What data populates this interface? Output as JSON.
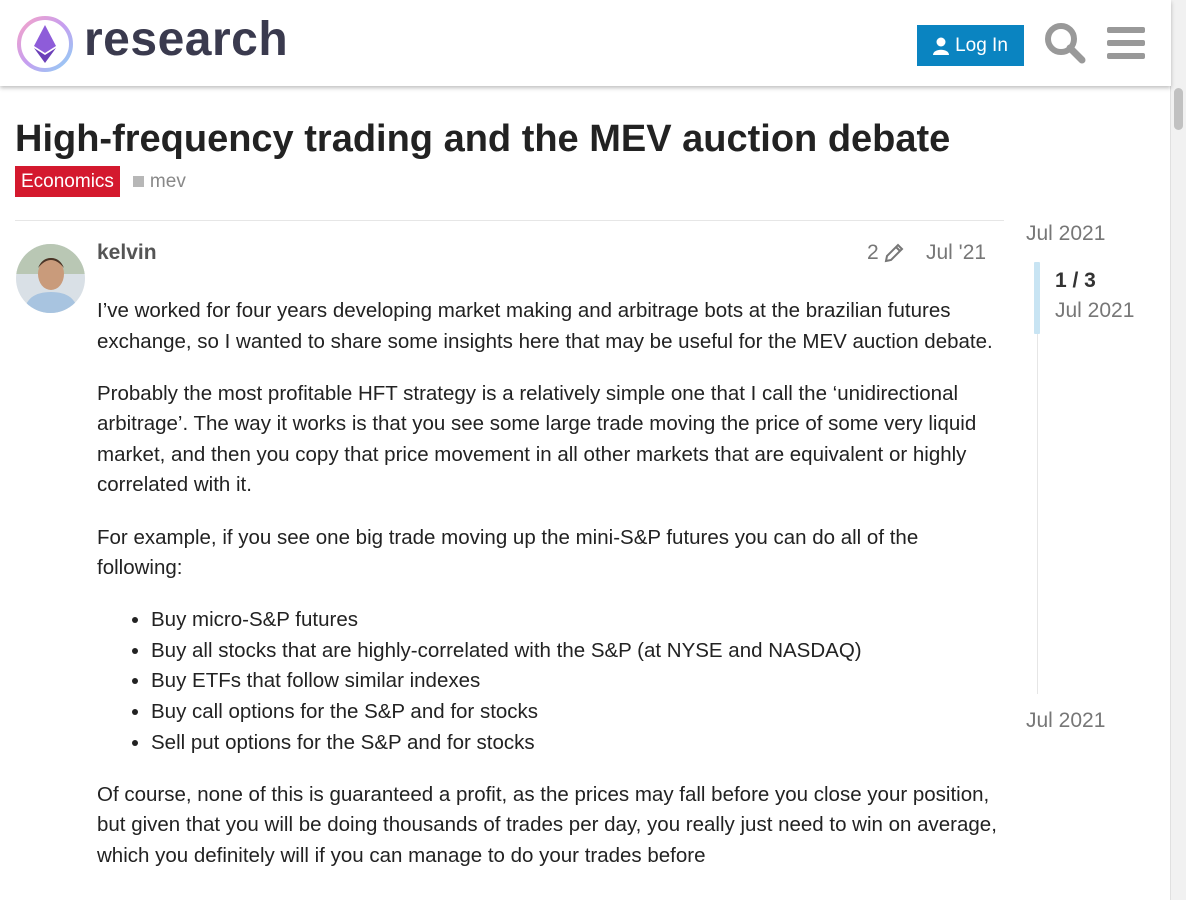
{
  "header": {
    "logo_text": "research",
    "login_label": "Log In",
    "search_icon": "search-icon",
    "menu_icon": "hamburger-menu-icon"
  },
  "topic": {
    "title": "High-frequency trading and the MEV auction debate",
    "category": "Economics",
    "category_color": "#d4192e",
    "tag": "mev"
  },
  "post": {
    "author": "kelvin",
    "edit_count": "2",
    "date": "Jul '21",
    "paragraphs": [
      "I’ve worked for four years developing market making and arbitrage bots at the brazilian futures exchange, so I wanted to share some insights here that may be useful for the MEV auction debate.",
      "Probably the most profitable HFT strategy is a relatively simple one that I call the ‘unidirectional arbitrage’. The way it works is that you see some large trade moving the price of some very liquid market, and then you copy that price movement in all other markets that are equivalent or highly correlated with it.",
      "For example, if you see one big trade moving up the mini-S&P futures you can do all of the following:"
    ],
    "list_items": [
      "Buy micro-S&P futures",
      "Buy all stocks that are highly-correlated with the S&P (at NYSE and NASDAQ)",
      "Buy ETFs that follow similar indexes",
      "Buy call options for the S&P and for stocks",
      "Sell put options for the S&P and for stocks"
    ],
    "closing": "Of course, none of this is guaranteed a profit, as the prices may fall before you close your position, but given that you will be doing thousands of trades per day, you really just need to win on average, which you definitely will if you can manage to do your trades before"
  },
  "timeline": {
    "start_date": "Jul 2021",
    "position": "1 / 3",
    "current_date": "Jul 2021",
    "end_date": "Jul 2021"
  },
  "colors": {
    "accent": "#0a84c1",
    "category": "#d4192e"
  }
}
